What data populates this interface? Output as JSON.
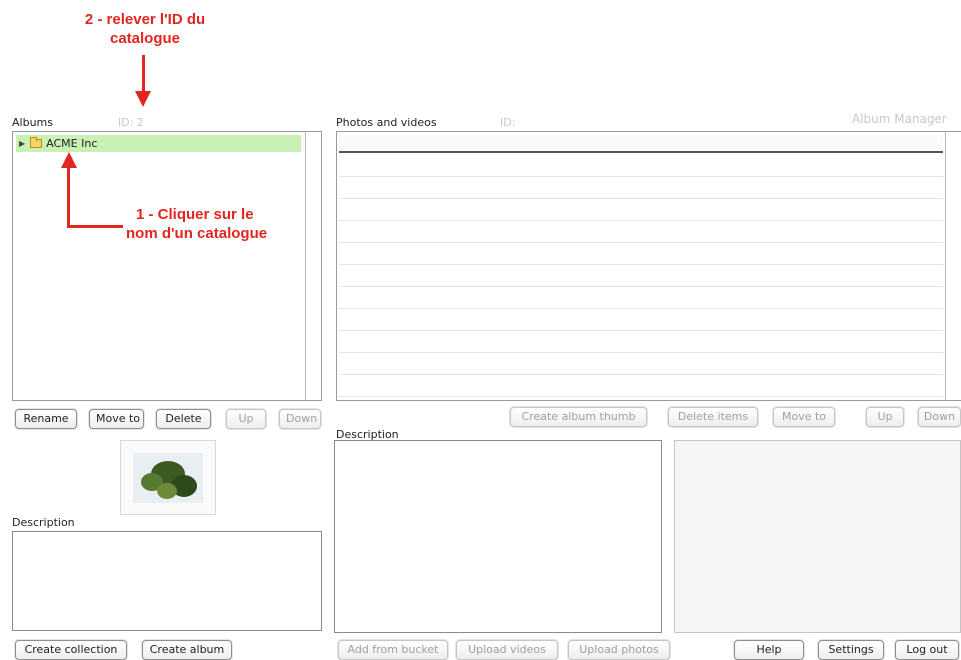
{
  "annotations": {
    "step2_line1": "2 - relever l'ID du",
    "step2_line2": "catalogue",
    "step1_line1": "1 - Cliquer sur le",
    "step1_line2": "nom d'un catalogue",
    "color": "#e0261f"
  },
  "albums": {
    "label": "Albums",
    "id_label": "ID: 2",
    "tree": [
      {
        "label": "ACME Inc",
        "icon": "folder-icon",
        "expander": "expand-arrow-icon",
        "selected": true
      }
    ],
    "buttons": {
      "rename": "Rename",
      "move_to": "Move to",
      "delete": "Delete",
      "up": "Up",
      "down": "Down"
    },
    "thumbnail_icon": "album-thumbnail-image"
  },
  "album_description": {
    "label": "Description"
  },
  "photos": {
    "label": "Photos and videos",
    "id_label": "ID:",
    "app_title": "Album Manager",
    "buttons": {
      "create_thumb": "Create album thumb",
      "delete_items": "Delete items",
      "move_to": "Move to",
      "up": "Up",
      "down": "Down"
    }
  },
  "item_description": {
    "label": "Description"
  },
  "footer": {
    "create_collection": "Create collection",
    "create_album": "Create album",
    "add_from_bucket": "Add from bucket",
    "upload_videos": "Upload videos",
    "upload_photos": "Upload photos",
    "help": "Help",
    "settings": "Settings",
    "log_out": "Log out"
  },
  "colors": {
    "selection": "#c9f0b5",
    "annotation": "#e0261f"
  }
}
